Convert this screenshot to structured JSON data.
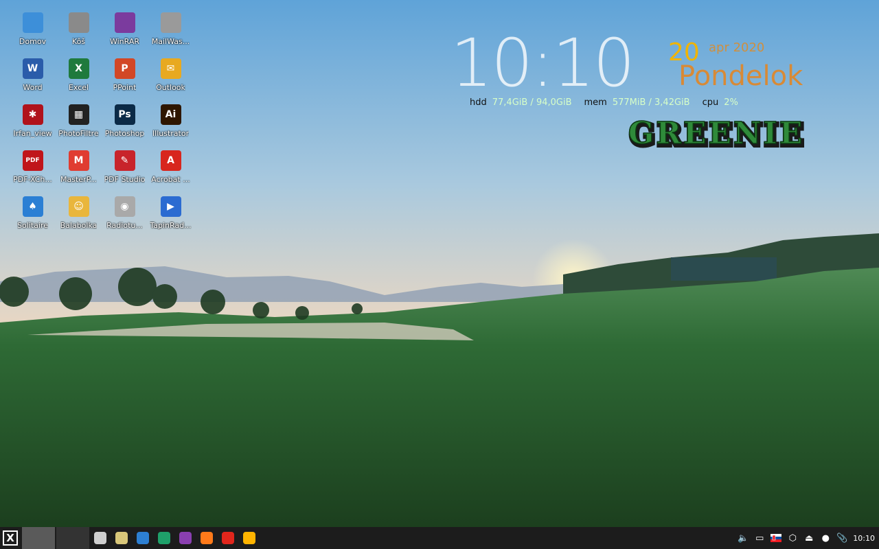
{
  "desktop": {
    "icons": [
      [
        {
          "label": "Domov",
          "icon": "home-folder-icon",
          "color": "#3d8fd9"
        },
        {
          "label": "Kôš",
          "icon": "trash-icon",
          "color": "#8a8a8a"
        },
        {
          "label": "WinRAR",
          "icon": "winrar-icon",
          "color": "#7b3b9e"
        },
        {
          "label": "MailWas...",
          "icon": "mailwasher-icon",
          "color": "#9a9a9a"
        }
      ],
      [
        {
          "label": "Word",
          "icon": "word-icon",
          "glyph": "W",
          "color": "#2a5caa"
        },
        {
          "label": "Excel",
          "icon": "excel-icon",
          "glyph": "X",
          "color": "#1f7a3d"
        },
        {
          "label": "PPoint",
          "icon": "powerpoint-icon",
          "glyph": "P",
          "color": "#d24726"
        },
        {
          "label": "Outlook",
          "icon": "outlook-icon",
          "glyph": "✉",
          "color": "#e8a920"
        }
      ],
      [
        {
          "label": "Irfan_view",
          "icon": "irfanview-icon",
          "glyph": "✱",
          "color": "#b0121b"
        },
        {
          "label": "PhotoFiltre",
          "icon": "photofiltre-icon",
          "glyph": "▦",
          "color": "#222"
        },
        {
          "label": "Photoshop",
          "icon": "photoshop-icon",
          "glyph": "Ps",
          "color": "#0b2a47"
        },
        {
          "label": "Illustrator",
          "icon": "illustrator-icon",
          "glyph": "Ai",
          "color": "#2e1600"
        }
      ],
      [
        {
          "label": "PDF-XCh...",
          "icon": "pdf-xchange-icon",
          "glyph": "PDF",
          "color": "#c0151b"
        },
        {
          "label": "MasterP...",
          "icon": "masterpdf-icon",
          "glyph": "M",
          "color": "#e03c31"
        },
        {
          "label": "PDF Studio",
          "icon": "pdf-studio-icon",
          "glyph": "✎",
          "color": "#c8242b"
        },
        {
          "label": "Acrobat ...",
          "icon": "acrobat-icon",
          "glyph": "A",
          "color": "#d8261d"
        }
      ],
      [
        {
          "label": "Solitaire",
          "icon": "solitaire-icon",
          "glyph": "♠",
          "color": "#2b7fd4"
        },
        {
          "label": "Balabolka",
          "icon": "balabolka-icon",
          "glyph": "☺",
          "color": "#e9b63c"
        },
        {
          "label": "Radiotu...",
          "icon": "radiotray-icon",
          "glyph": "◉",
          "color": "#a9a9a9"
        },
        {
          "label": "TapinRad...",
          "icon": "tapinradio-icon",
          "glyph": "▶",
          "color": "#2b6bd1"
        }
      ]
    ]
  },
  "conky": {
    "time": "10:10",
    "day": "20",
    "month_year": "apr 2020",
    "weekday": "Pondelok",
    "hdd_label": "hdd",
    "hdd_value": "77,4GiB / 94,0GiB",
    "mem_label": "mem",
    "mem_value": "577MiB / 3,42GiB",
    "cpu_label": "cpu",
    "cpu_value": "2%",
    "logo_text": "GREENIE"
  },
  "taskbar": {
    "start_glyph": "X",
    "launchers": [
      {
        "icon": "terminal-icon",
        "color": "#cfcfcf"
      },
      {
        "icon": "file-manager-icon",
        "color": "#d9c77a"
      },
      {
        "icon": "text-editor-icon",
        "color": "#2d7fd2"
      },
      {
        "icon": "app-store-icon",
        "color": "#1fa06a"
      },
      {
        "icon": "winrar-icon",
        "color": "#8a3fb0"
      },
      {
        "icon": "firefox-icon",
        "color": "#ff7a1a"
      },
      {
        "icon": "opera-icon",
        "color": "#e1261c"
      },
      {
        "icon": "pinwheel-icon",
        "color": "#ffb400"
      }
    ],
    "tray": [
      {
        "icon": "volume-icon",
        "glyph": "🔈"
      },
      {
        "icon": "display-icon",
        "glyph": "▭"
      },
      {
        "icon": "slovak-flag-icon",
        "glyph": ""
      },
      {
        "icon": "package-icon",
        "glyph": "⬡"
      },
      {
        "icon": "eject-icon",
        "glyph": "⏏"
      },
      {
        "icon": "update-icon",
        "glyph": "●"
      },
      {
        "icon": "clip-icon",
        "glyph": "📎"
      }
    ],
    "clock": "10:10"
  }
}
